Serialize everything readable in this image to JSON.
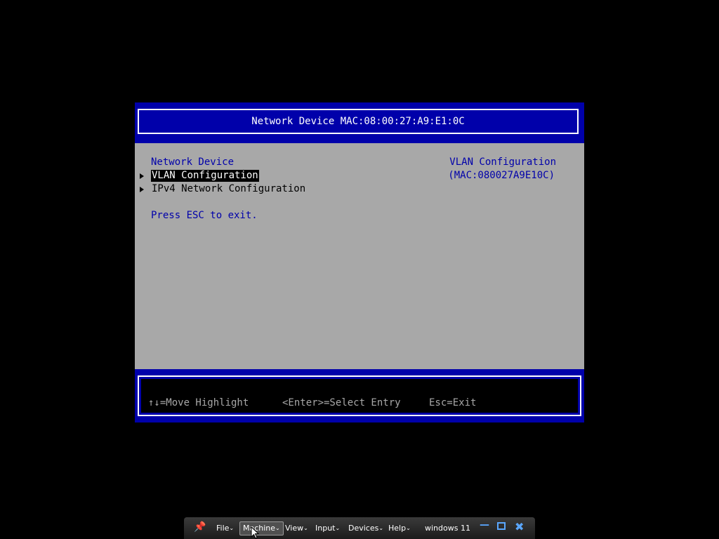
{
  "bios": {
    "title": "Network Device MAC:08:00:27:A9:E1:0C",
    "section_heading": "Network Device",
    "menu_items": [
      {
        "label": "VLAN Configuration",
        "selected": true
      },
      {
        "label": "IPv4 Network Configuration",
        "selected": false
      }
    ],
    "exit_hint": "Press ESC to exit.",
    "help_panel": {
      "title": "VLAN Configuration",
      "mac": "(MAC:080027A9E10C)"
    },
    "footer": {
      "move": "↑↓=Move Highlight",
      "select": "<Enter>=Select Entry",
      "exit": "Esc=Exit"
    },
    "colors": {
      "band_blue": "#0000aa",
      "panel_gray": "#a8a8a8",
      "text_white": "#ffffff"
    }
  },
  "vm_toolbar": {
    "pin_icon": "pin-icon",
    "menus": [
      "File",
      "Machine",
      "View",
      "Input",
      "Devices",
      "Help"
    ],
    "vm_name": "windows 11",
    "window_controls": [
      "minimize-icon",
      "restore-icon",
      "close-icon"
    ]
  }
}
